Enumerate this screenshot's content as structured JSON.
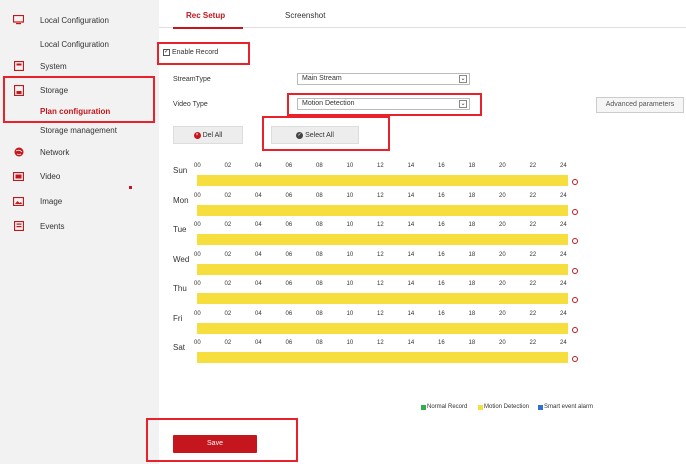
{
  "sidebar": {
    "items": [
      {
        "key": "local",
        "label": "Local Configuration",
        "icon": "monitor-icon"
      },
      {
        "key": "system",
        "label": "System",
        "icon": "system-icon"
      },
      {
        "key": "storage",
        "label": "Storage",
        "icon": "storage-icon"
      },
      {
        "key": "network",
        "label": "Network",
        "icon": "globe-icon"
      },
      {
        "key": "video",
        "label": "Video",
        "icon": "video-icon"
      },
      {
        "key": "image",
        "label": "Image",
        "icon": "image-icon"
      },
      {
        "key": "events",
        "label": "Events",
        "icon": "events-icon"
      }
    ],
    "sub_local": "Local Configuration",
    "sub_plan": "Plan configuration",
    "sub_storage_mgmt": "Storage management"
  },
  "tabs": [
    {
      "label": "Rec Setup",
      "active": true
    },
    {
      "label": "Screenshot",
      "active": false
    }
  ],
  "form": {
    "enable_record_label": "Enable Record",
    "enable_record_checked": true,
    "stream_type_label": "StreamType",
    "stream_type_value": "Main Stream",
    "video_type_label": "Video Type",
    "video_type_value": "Motion Detection",
    "advanced_label": "Advanced parameters",
    "del_all_label": "Del All",
    "select_all_label": "Select All"
  },
  "schedule": {
    "days": [
      "Sun",
      "Mon",
      "Tue",
      "Wed",
      "Thu",
      "Fri",
      "Sat"
    ],
    "ticks": [
      "00",
      "02",
      "04",
      "06",
      "08",
      "10",
      "12",
      "14",
      "16",
      "18",
      "20",
      "22",
      "24"
    ],
    "bar_color": "#f5de3e"
  },
  "legend": [
    {
      "label": "Normal Record",
      "color": "#2db24a"
    },
    {
      "label": "Motion Detection",
      "color": "#f5de3e"
    },
    {
      "label": "Smart event alarm",
      "color": "#2f6fd6"
    }
  ],
  "save_label": "Save",
  "colors": {
    "accent": "#c4161c",
    "highlight": "#e8212b"
  }
}
